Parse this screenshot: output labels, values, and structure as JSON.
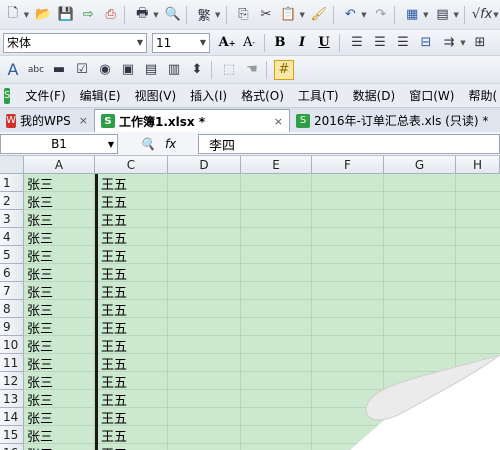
{
  "toolbar_standard": {
    "icons": [
      "new-document-icon",
      "open-folder-icon",
      "save-icon",
      "export-icon",
      "pdf-icon",
      "print-icon",
      "print-preview-icon",
      "format-brush-icon",
      "copy-icon",
      "cut-icon",
      "paste-icon",
      "clear-format-icon",
      "undo-icon",
      "redo-icon",
      "table-grid-icon",
      "freeze-icon",
      "fx-function-icon",
      "dropdown-icon"
    ]
  },
  "toolbar_format": {
    "font_name": "宋体",
    "font_size": "11",
    "bold": "B",
    "italic": "I",
    "underline": "U"
  },
  "menu": {
    "items": [
      "文件(F)",
      "编辑(E)",
      "视图(V)",
      "插入(I)",
      "格式(O)",
      "工具(T)",
      "数据(D)",
      "窗口(W)",
      "帮助("
    ]
  },
  "tabs": [
    {
      "label": "我的WPS",
      "close": "×",
      "active": false
    },
    {
      "label": "工作簿1.xlsx *",
      "close": "×",
      "active": true
    },
    {
      "label": "2016年-订单汇总表.xls (只读) *",
      "close": "",
      "active": false
    }
  ],
  "formula_bar": {
    "cell_ref": "B1",
    "fx": "fx",
    "value": "李四"
  },
  "sheet": {
    "columns": [
      "A",
      "C",
      "D",
      "E",
      "F",
      "G",
      "H"
    ],
    "rows": [
      "1",
      "2",
      "3",
      "4",
      "5",
      "6",
      "7",
      "8",
      "9",
      "10",
      "11",
      "12",
      "13",
      "14",
      "15",
      "16"
    ],
    "col_a": [
      "张三",
      "张三",
      "张三",
      "张三",
      "张三",
      "张三",
      "张三",
      "张三",
      "张三",
      "张三",
      "张三",
      "张三",
      "张三",
      "张三",
      "张三",
      "张三"
    ],
    "col_c": [
      "王五",
      "王五",
      "王五",
      "王五",
      "王五",
      "王五",
      "王五",
      "王五",
      "王五",
      "王五",
      "王五",
      "王五",
      "王五",
      "王五",
      "王五",
      "王五"
    ]
  },
  "colors": {
    "cell_background": "#cce8cf",
    "header_background": "#e4e9f0"
  }
}
